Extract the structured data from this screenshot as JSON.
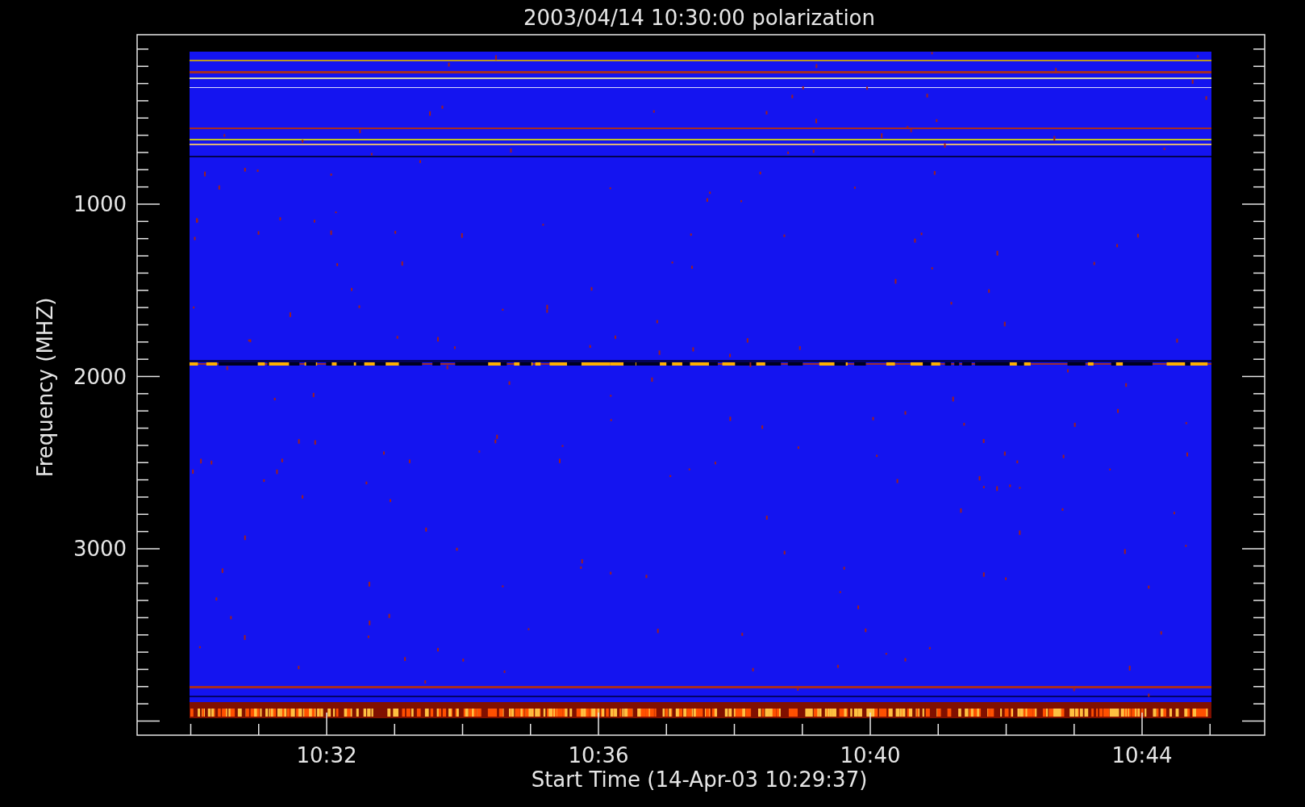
{
  "plot": {
    "title": "2003/04/14 10:30:00 polarization",
    "ylabel": "Frequency (MHZ)",
    "xlabel": "Start Time (14-Apr-03 10:29:37)",
    "yticks": [
      "1000",
      "2000",
      "3000"
    ],
    "xticks": [
      "10:32",
      "10:36",
      "10:40",
      "10:44"
    ]
  }
}
